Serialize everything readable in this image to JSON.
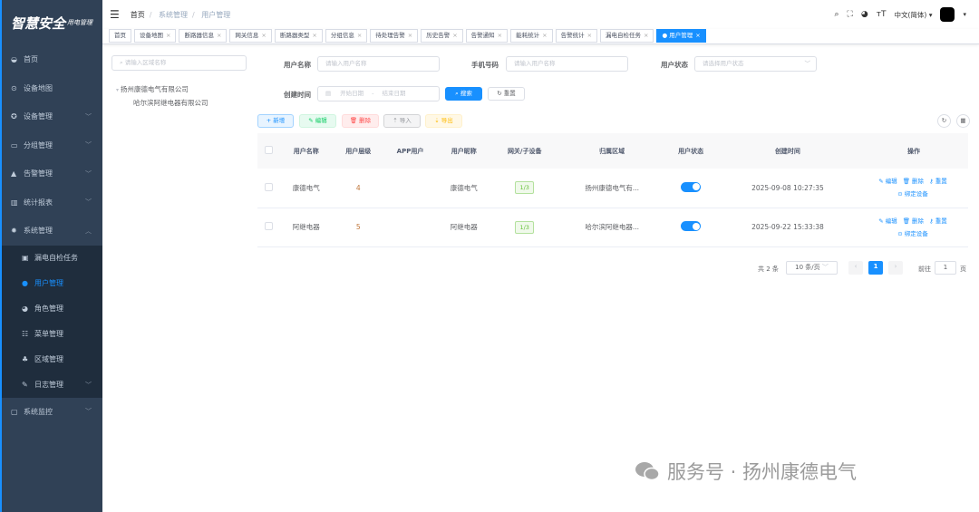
{
  "logo": {
    "title": "智慧安全",
    "subtitle": "用电管理"
  },
  "sidebar": {
    "items": [
      {
        "label": "首页",
        "icon": "dashboard-icon"
      },
      {
        "label": "设备地图",
        "icon": "map-pin-icon"
      },
      {
        "label": "设备管理",
        "icon": "device-icon"
      },
      {
        "label": "分组管理",
        "icon": "group-icon"
      },
      {
        "label": "告警管理",
        "icon": "alarm-icon"
      },
      {
        "label": "统计报表",
        "icon": "chart-icon"
      },
      {
        "label": "系统管理",
        "icon": "gear-icon"
      }
    ],
    "sub_items": [
      {
        "label": "漏电自检任务",
        "icon": "task-icon"
      },
      {
        "label": "用户管理",
        "icon": "user-icon"
      },
      {
        "label": "角色管理",
        "icon": "role-icon"
      },
      {
        "label": "菜单管理",
        "icon": "menu-icon"
      },
      {
        "label": "区域管理",
        "icon": "tree-icon"
      },
      {
        "label": "日志管理",
        "icon": "log-icon"
      }
    ],
    "last_item": {
      "label": "系统监控",
      "icon": "monitor-icon"
    }
  },
  "header": {
    "breadcrumb": [
      "首页",
      "系统管理",
      "用户管理"
    ],
    "language": "中文(简体)"
  },
  "tags": [
    "首页",
    "设备地图",
    "断路器信息",
    "网关信息",
    "断路器类型",
    "分组信息",
    "待处理告警",
    "历史告警",
    "告警通知",
    "能耗统计",
    "告警统计",
    "漏电自检任务",
    "用户管理"
  ],
  "tree": {
    "search_placeholder": "请输入区域名称",
    "nodes": [
      "扬州康德电气有限公司",
      "哈尔滨阿继电器有限公司"
    ]
  },
  "filters": {
    "username_label": "用户名称",
    "username_placeholder": "请输入用户名称",
    "phone_label": "手机号码",
    "phone_placeholder": "请输入用户名称",
    "status_label": "用户状态",
    "status_placeholder": "请选择用户状态",
    "time_label": "创建时间",
    "start_placeholder": "开始日期",
    "end_placeholder": "结束日期",
    "search": "搜索",
    "reset": "重置"
  },
  "toolbar": {
    "add": "新增",
    "edit": "编辑",
    "delete": "删除",
    "import": "导入",
    "export": "导出"
  },
  "table": {
    "headers": [
      "用户名称",
      "用户层级",
      "APP用户",
      "用户昵称",
      "网关/子设备",
      "归属区域",
      "用户状态",
      "创建时间",
      "操作"
    ],
    "rows": [
      {
        "name": "康德电气",
        "level": "4",
        "app": "",
        "nickname": "康德电气",
        "gateway": "1/3",
        "region": "扬州康德电气有...",
        "enabled": true,
        "created": "2025-09-08 10:27:35"
      },
      {
        "name": "阿继电器",
        "level": "5",
        "app": "",
        "nickname": "阿继电器",
        "gateway": "1/3",
        "region": "哈尔滨阿继电器...",
        "enabled": true,
        "created": "2025-09-22 15:33:38"
      }
    ],
    "actions": {
      "edit": "编辑",
      "delete": "删除",
      "reset": "重置",
      "bind": "绑定设备"
    }
  },
  "pagination": {
    "total": "共 2 条",
    "page_size": "10 条/页",
    "current": "1",
    "goto_label": "前往",
    "goto_value": "1",
    "page_suffix": "页"
  },
  "watermark": "服务号 · 扬州康德电气",
  "colors": {
    "sidebar": "#304156",
    "primary": "#1890ff",
    "success": "#67c23a",
    "danger": "#f56c6c",
    "warning": "#e6a23c"
  }
}
